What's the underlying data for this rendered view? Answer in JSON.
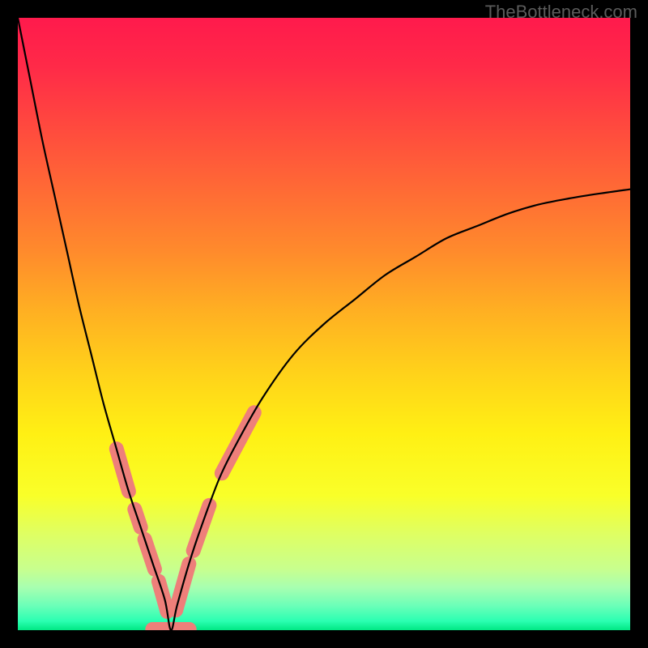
{
  "watermark": "TheBottleneck.com",
  "gradient": {
    "stops": [
      {
        "offset": 0.0,
        "color": "#ff1a4c"
      },
      {
        "offset": 0.08,
        "color": "#ff2a48"
      },
      {
        "offset": 0.18,
        "color": "#ff4a3e"
      },
      {
        "offset": 0.28,
        "color": "#ff6a35"
      },
      {
        "offset": 0.38,
        "color": "#ff8a2c"
      },
      {
        "offset": 0.48,
        "color": "#ffb022"
      },
      {
        "offset": 0.58,
        "color": "#ffd21a"
      },
      {
        "offset": 0.68,
        "color": "#fff014"
      },
      {
        "offset": 0.78,
        "color": "#f9ff29"
      },
      {
        "offset": 0.84,
        "color": "#e0ff60"
      },
      {
        "offset": 0.9,
        "color": "#c8ff8e"
      },
      {
        "offset": 0.93,
        "color": "#a8ffb0"
      },
      {
        "offset": 0.96,
        "color": "#6bffb8"
      },
      {
        "offset": 0.985,
        "color": "#2bffb2"
      },
      {
        "offset": 1.0,
        "color": "#00e884"
      }
    ]
  },
  "chart_data": {
    "type": "line",
    "title": "",
    "xlabel": "",
    "ylabel": "",
    "xlim": [
      0,
      100
    ],
    "ylim": [
      0,
      100
    ],
    "dip_x": 25,
    "left_start_y": 100,
    "right_end_y": 72,
    "series": [
      {
        "name": "bottleneck-curve",
        "x": [
          0,
          2,
          4,
          6,
          8,
          10,
          12,
          14,
          16,
          18,
          20,
          22,
          24,
          25,
          26,
          28,
          30,
          33,
          36,
          40,
          45,
          50,
          55,
          60,
          65,
          70,
          75,
          80,
          85,
          90,
          95,
          100
        ],
        "y": [
          100,
          90,
          80,
          71,
          62,
          53,
          45,
          37,
          30,
          23,
          17,
          11,
          5,
          0,
          4,
          11,
          17,
          25,
          31,
          38,
          45,
          50,
          54,
          58,
          61,
          64,
          66,
          68,
          69.5,
          70.5,
          71.3,
          72
        ]
      }
    ],
    "markers": {
      "comment": "salmon segments overlaid near the dip on both branches",
      "color": "#ee7f7a",
      "radius_px": 9,
      "caps": [
        {
          "branch": "left",
          "t0": 0.7,
          "t1": 0.77
        },
        {
          "branch": "left",
          "t0": 0.8,
          "t1": 0.83
        },
        {
          "branch": "left",
          "t0": 0.85,
          "t1": 0.9
        },
        {
          "branch": "left",
          "t0": 0.92,
          "t1": 0.97
        },
        {
          "branch": "bottom",
          "t0": 0.0,
          "t1": 1.0
        },
        {
          "branch": "right",
          "t0": 0.03,
          "t1": 0.1
        },
        {
          "branch": "right",
          "t0": 0.12,
          "t1": 0.19
        },
        {
          "branch": "right",
          "t0": 0.24,
          "t1": 0.34
        }
      ]
    }
  }
}
